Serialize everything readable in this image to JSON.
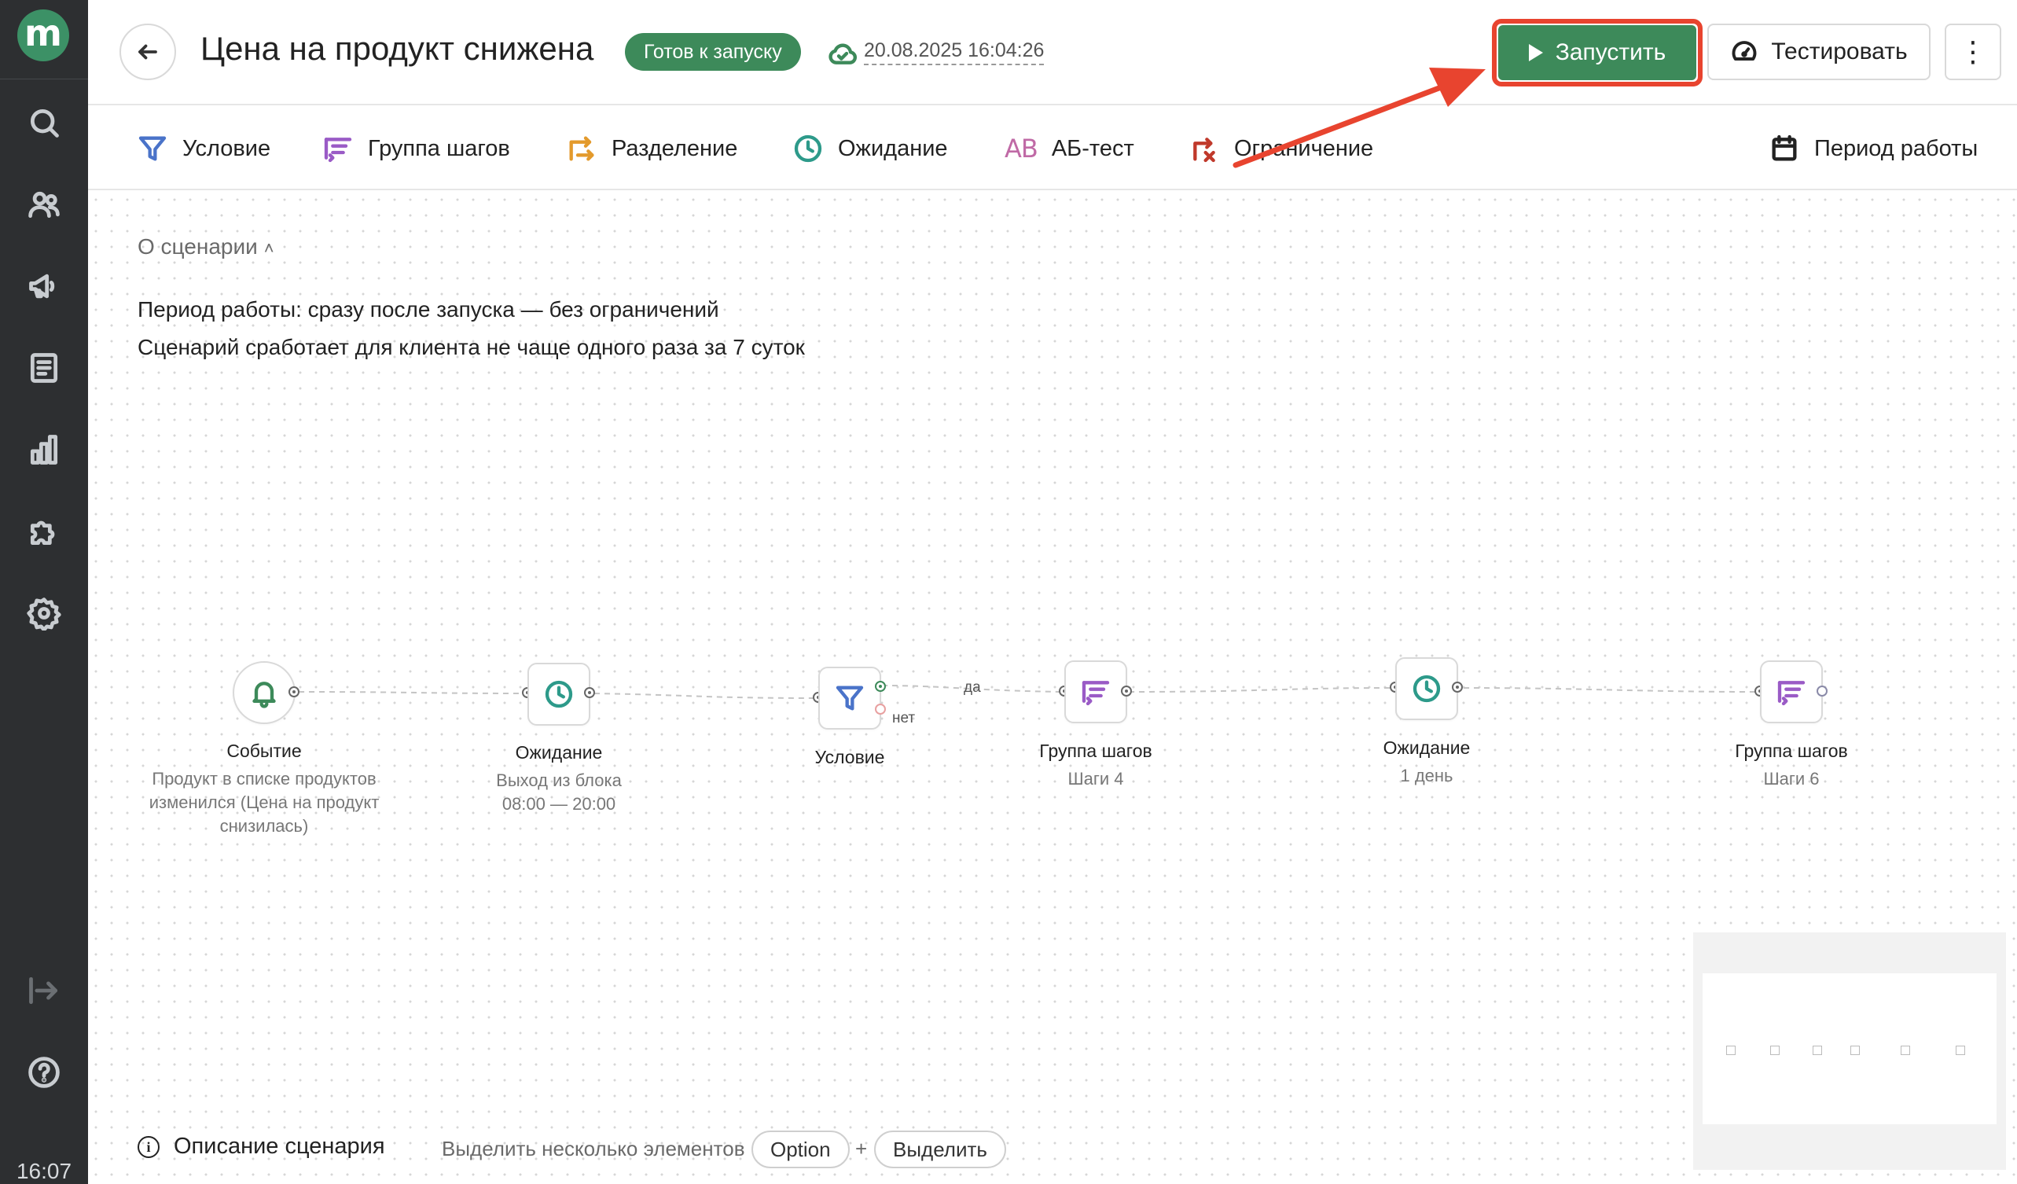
{
  "sidebar": {
    "logo": "m",
    "items": [
      {
        "icon": "search-icon"
      },
      {
        "icon": "users-icon"
      },
      {
        "icon": "megaphone-icon"
      },
      {
        "icon": "document-icon"
      },
      {
        "icon": "chart-icon"
      },
      {
        "icon": "puzzle-icon"
      },
      {
        "icon": "gear-icon"
      }
    ],
    "bottom_items": [
      {
        "icon": "logout-icon"
      },
      {
        "icon": "help-icon"
      }
    ],
    "time": "16:07"
  },
  "header": {
    "title": "Цена на продукт снижена",
    "status": "Готов к запуску",
    "saved_at": "20.08.2025 16:04:26",
    "launch_label": "Запустить",
    "test_label": "Тестировать",
    "more_label": "⋮"
  },
  "toolbar": {
    "items": [
      {
        "label": "Условие",
        "icon": "filter-icon"
      },
      {
        "label": "Группа шагов",
        "icon": "steps-group-icon"
      },
      {
        "label": "Разделение",
        "icon": "split-icon"
      },
      {
        "label": "Ожидание",
        "icon": "clock-icon"
      },
      {
        "label": "АБ-тест",
        "icon": "ab-icon",
        "glyph": "AB"
      },
      {
        "label": "Ограничение",
        "icon": "limit-icon"
      }
    ],
    "period_label": "Период работы"
  },
  "about": {
    "toggle_label": "О сценарии",
    "lines": [
      "Период работы: сразу после запуска — без ограничений",
      "Сценарий сработает для клиента не чаще одного раза за 7 суток"
    ]
  },
  "flow": {
    "nodes": [
      {
        "title": "Событие",
        "subtitle": "Продукт в списке продуктов изменился (Цена на продукт снизилась)",
        "icon": "bell-icon"
      },
      {
        "title": "Ожидание",
        "subtitle": "Выход из блока 08:00 — 20:00",
        "icon": "clock-icon"
      },
      {
        "title": "Условие",
        "subtitle": "",
        "icon": "filter-icon"
      },
      {
        "title": "Группа шагов",
        "subtitle": "Шаги 4",
        "icon": "steps-group-icon"
      },
      {
        "title": "Ожидание",
        "subtitle": "1 день",
        "icon": "clock-icon"
      },
      {
        "title": "Группа шагов",
        "subtitle": "Шаги 6",
        "icon": "steps-group-icon"
      }
    ],
    "edge_yes": "да",
    "edge_no": "нет"
  },
  "footer": {
    "description_label": "Описание сценария",
    "hint": "Выделить несколько элементов",
    "key1": "Option",
    "plus": "+",
    "key2": "Выделить"
  },
  "colors": {
    "accent_green": "#3d8a5a",
    "sidebar_bg": "#2d2f31",
    "highlight_red": "#e8442f"
  }
}
